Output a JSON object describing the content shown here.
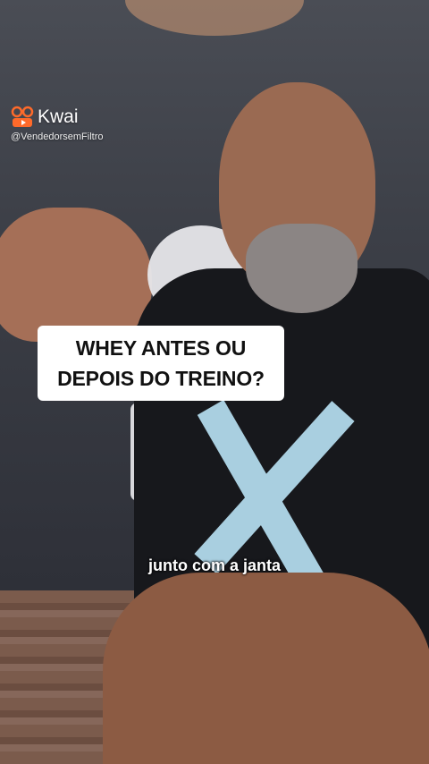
{
  "watermark": {
    "app_name": "Kwai",
    "username": "@VendedorsemFiltro"
  },
  "overlay": {
    "title_line1": "WHEY ANTES OU",
    "title_line2": "DEPOIS DO TREINO?",
    "subtitle": "junto com a janta"
  },
  "colors": {
    "kwai_brand": "#ff6a2a",
    "title_bg": "#ffffff",
    "hoodie": "#17181c",
    "logo_accent": "#a9cfe0"
  },
  "icons": {
    "kwai_logo": "kwai-logo-icon"
  }
}
